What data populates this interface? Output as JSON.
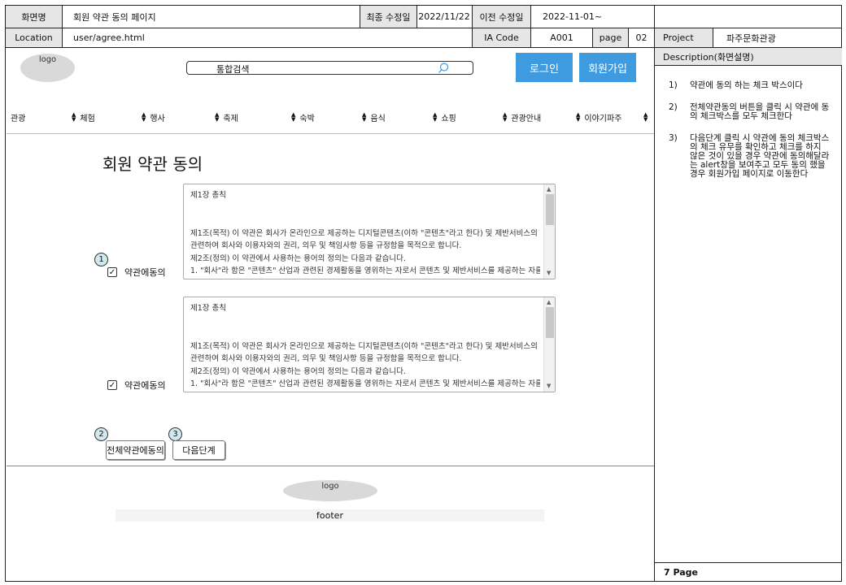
{
  "meta": {
    "screen_name_label": "화면명",
    "screen_name": "회원 약관 동의 페이지",
    "last_modified_label": "최종 수정일",
    "last_modified": "2022/11/22",
    "prev_modified_label": "이전 수정일",
    "prev_modified": "2022-11-01~",
    "location_label": "Location",
    "location": "user/agree.html",
    "ia_code_label": "IA Code",
    "ia_code": "A001",
    "page_label": "page",
    "page": "02",
    "project_label": "Project",
    "project": "파주문화관광",
    "description_label": "Description(화면설명)",
    "page_footer": "7 Page"
  },
  "descriptions": [
    {
      "num": "1)",
      "text": "약관에 동의 하는 체크 박스이다"
    },
    {
      "num": "2)",
      "text": "전체약관동의 버튼을 클릭 시 약관에 동의 체크박스를 모두 체크한다"
    },
    {
      "num": "3)",
      "text": "다음단계 클릭 시 약관에 동의 체크박스의 체크 유무를 확인하고 체크를 하지 않은 것이 있을 경우 약관에 동의해달라는 alert창을 보여주고 모두 동의 했을 경우 회원가입 페이지로 이동한다"
    }
  ],
  "site": {
    "logo_text": "logo",
    "search_placeholder": "통합검색",
    "login_label": "로그인",
    "signup_label": "회원가입",
    "nav": [
      "관광",
      "체험",
      "행사",
      "축제",
      "숙박",
      "음식",
      "쇼핑",
      "관광안내",
      "이야기파주"
    ],
    "page_title": "회원 약관 동의",
    "terms": [
      {
        "heading": "제1장 총칙",
        "lines": [
          "제1조(목적) 이 약관은 회사가 온라인으로 제공하는 디지털콘텐츠(이하 \"콘텐츠\"라고 한다) 및 제반서비스의 이용과",
          "관련하여 회사와 이용자와의 권리, 의무 및 책임사항 등을 규정함을 목적으로 합니다.",
          "제2조(정의) 이 약관에서 사용하는 용어의 정의는 다음과 같습니다.",
          "1. \"회사\"라 함은 \"콘텐츠\" 산업과 관련된 경제활동을 영위하는 자로서 콘텐츠 및 제반서비스를 제공하는 자를 말합"
        ],
        "agree_label": "약관에동의",
        "checked": true
      },
      {
        "heading": "제1장 총칙",
        "lines": [
          "제1조(목적) 이 약관은 회사가 온라인으로 제공하는 디지털콘텐츠(이하 \"콘텐츠\"라고 한다) 및 제반서비스의 이용과",
          "관련하여 회사와 이용자와의 권리, 의무 및 책임사항 등을 규정함을 목적으로 합니다.",
          "제2조(정의) 이 약관에서 사용하는 용어의 정의는 다음과 같습니다.",
          "1. \"회사\"라 함은 \"콘텐츠\" 산업과 관련된 경제활동을 영위하는 자로서 콘텐츠 및 제반서비스를 제공하는 자를 말합"
        ],
        "agree_label": "약관에동의",
        "checked": true
      }
    ],
    "agree_all_label": "전체약관에동의",
    "next_label": "다음단계",
    "footer_logo": "logo",
    "footer_text": "footer",
    "badges": [
      "1",
      "2",
      "3"
    ]
  },
  "colors": {
    "accent_button": "#3f9be0",
    "badge_fill": "#cfe9ee",
    "header_shade": "#e6e6e6"
  }
}
